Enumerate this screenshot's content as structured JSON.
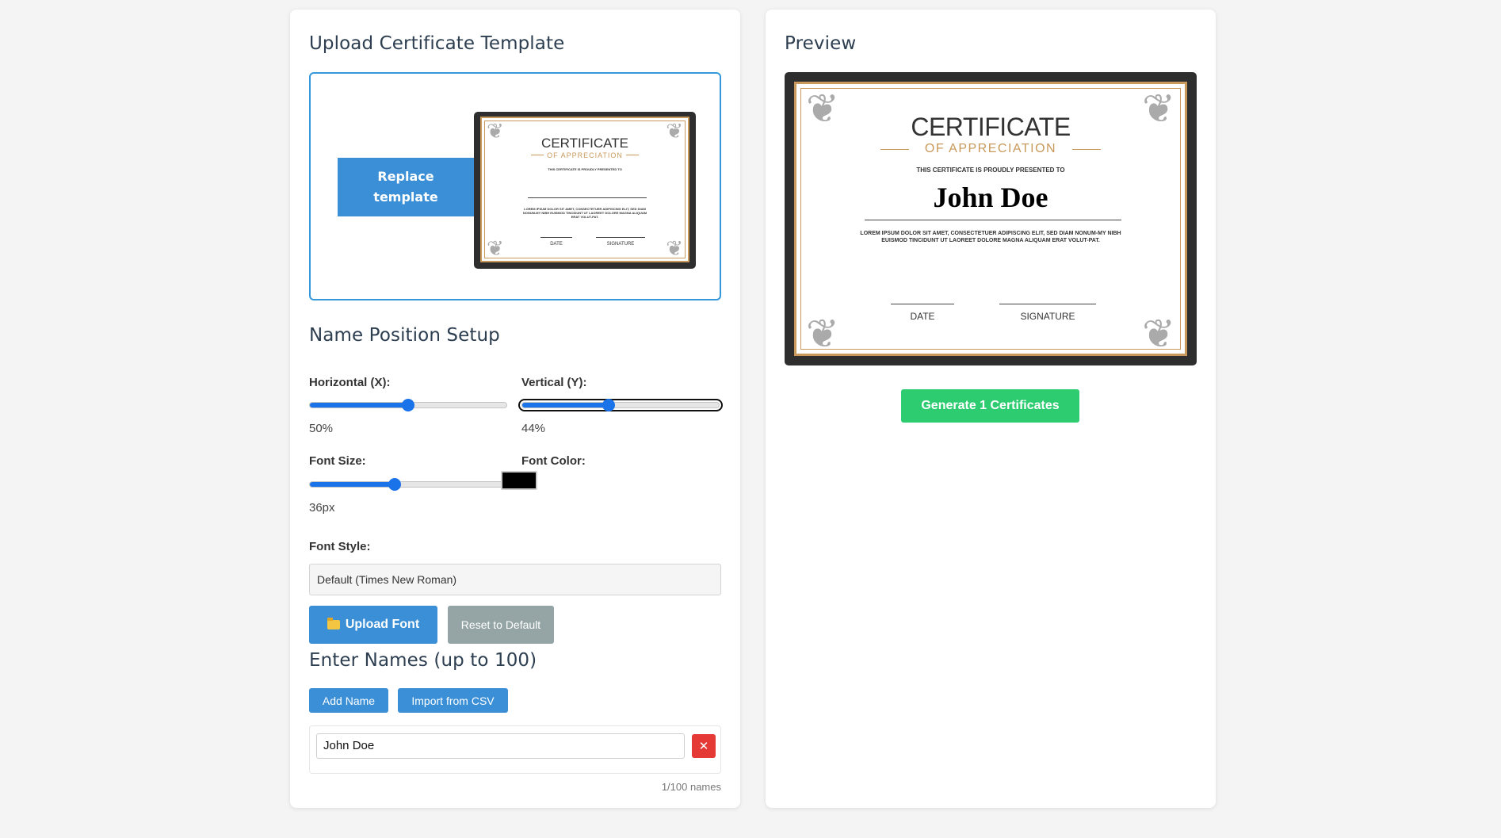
{
  "upload": {
    "title": "Upload Certificate Template",
    "replace_label": "Replace template"
  },
  "certificate": {
    "title": "CERTIFICATE",
    "subtitle": "OF APPRECIATION",
    "presented": "THIS CERTIFICATE IS PROUDLY PRESENTED TO",
    "name": "John Doe",
    "body": "LOREM IPSUM DOLOR SIT AMET, CONSECTETUER ADIPISCING ELIT, SED DIAM NONUM-MY NIBH EUISMOD TINCIDUNT UT LAOREET DOLORE MAGNA ALIQUAM ERAT VOLUT-PAT.",
    "date_label": "DATE",
    "signature_label": "SIGNATURE",
    "accent_color": "#c8995a"
  },
  "position": {
    "title": "Name Position Setup",
    "horizontal_label": "Horizontal (X):",
    "horizontal_value": "50%",
    "horizontal_fraction": 0.5,
    "vertical_label": "Vertical (Y):",
    "vertical_value": "44%",
    "vertical_fraction": 0.44,
    "font_size_label": "Font Size:",
    "font_size_value": "36px",
    "font_size_fraction": 0.43,
    "font_color_label": "Font Color:",
    "font_color": "#000000",
    "font_style_label": "Font Style:",
    "font_style_value": "Default (Times New Roman)",
    "upload_font_label": "Upload Font",
    "reset_label": "Reset to Default"
  },
  "names": {
    "title": "Enter Names (up to 100)",
    "add_label": "Add Name",
    "import_label": "Import from CSV",
    "items": [
      "John Doe"
    ],
    "delete_symbol": "✕",
    "count": "1/100 names"
  },
  "preview": {
    "title": "Preview",
    "generate_label": "Generate 1 Certificates"
  },
  "colors": {
    "primary": "#3a8fd6",
    "success": "#2ecc71",
    "danger": "#e53935",
    "muted": "#95a5a6",
    "slider": "#1a73e8"
  }
}
